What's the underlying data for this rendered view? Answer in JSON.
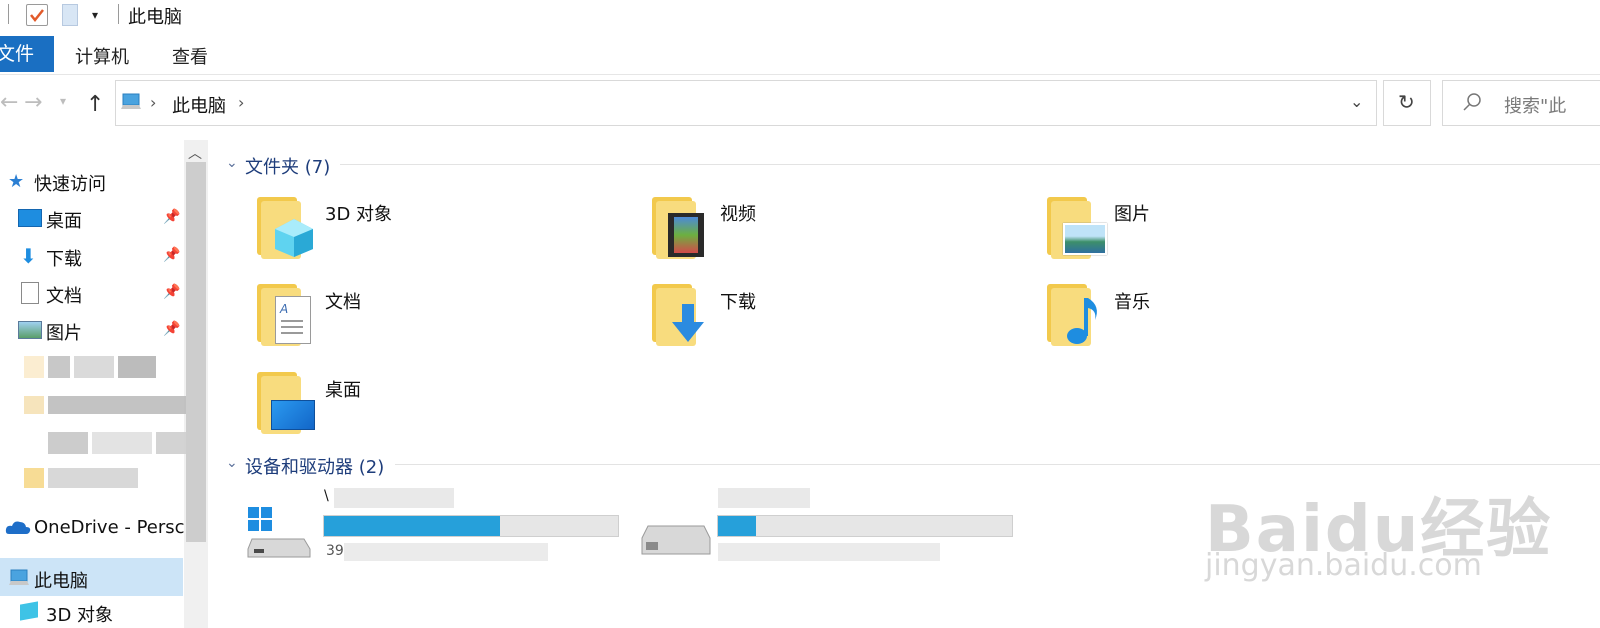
{
  "window": {
    "title": "此电脑"
  },
  "ribbon": {
    "tabs": [
      "文件",
      "计算机",
      "查看"
    ]
  },
  "address": {
    "segments": [
      "此电脑"
    ],
    "search_placeholder": "搜索\"此"
  },
  "nav": {
    "quick_access": "快速访问",
    "items": [
      {
        "label": "桌面",
        "pinned": true,
        "icon": "desktop-icon"
      },
      {
        "label": "下载",
        "pinned": true,
        "icon": "download-icon"
      },
      {
        "label": "文档",
        "pinned": true,
        "icon": "document-icon"
      },
      {
        "label": "图片",
        "pinned": true,
        "icon": "picture-icon"
      }
    ],
    "onedrive": "OneDrive - Persc",
    "this_pc": "此电脑",
    "subitem": "3D 对象"
  },
  "content": {
    "folders_group": "文件夹 (7)",
    "folders": [
      {
        "label": "3D 对象",
        "icon": "3d-objects-folder-icon"
      },
      {
        "label": "视频",
        "icon": "videos-folder-icon"
      },
      {
        "label": "图片",
        "icon": "pictures-folder-icon"
      },
      {
        "label": "文档",
        "icon": "documents-folder-icon"
      },
      {
        "label": "下载",
        "icon": "downloads-folder-icon"
      },
      {
        "label": "音乐",
        "icon": "music-folder-icon"
      },
      {
        "label": "桌面",
        "icon": "desktop-folder-icon"
      }
    ],
    "drives_group": "设备和驱动器 (2)",
    "drives": [
      {
        "usage": 0.6,
        "label_visible": "\\",
        "size_prefix": "39"
      },
      {
        "usage": 0.13
      }
    ]
  },
  "watermark": {
    "text": "Baidu经验",
    "url": "jingyan.baidu.com"
  },
  "colors": {
    "accent": "#1a6fc2",
    "folder": "#f8dc7e",
    "bar": "#26a0da",
    "selected": "#cce4f7"
  }
}
